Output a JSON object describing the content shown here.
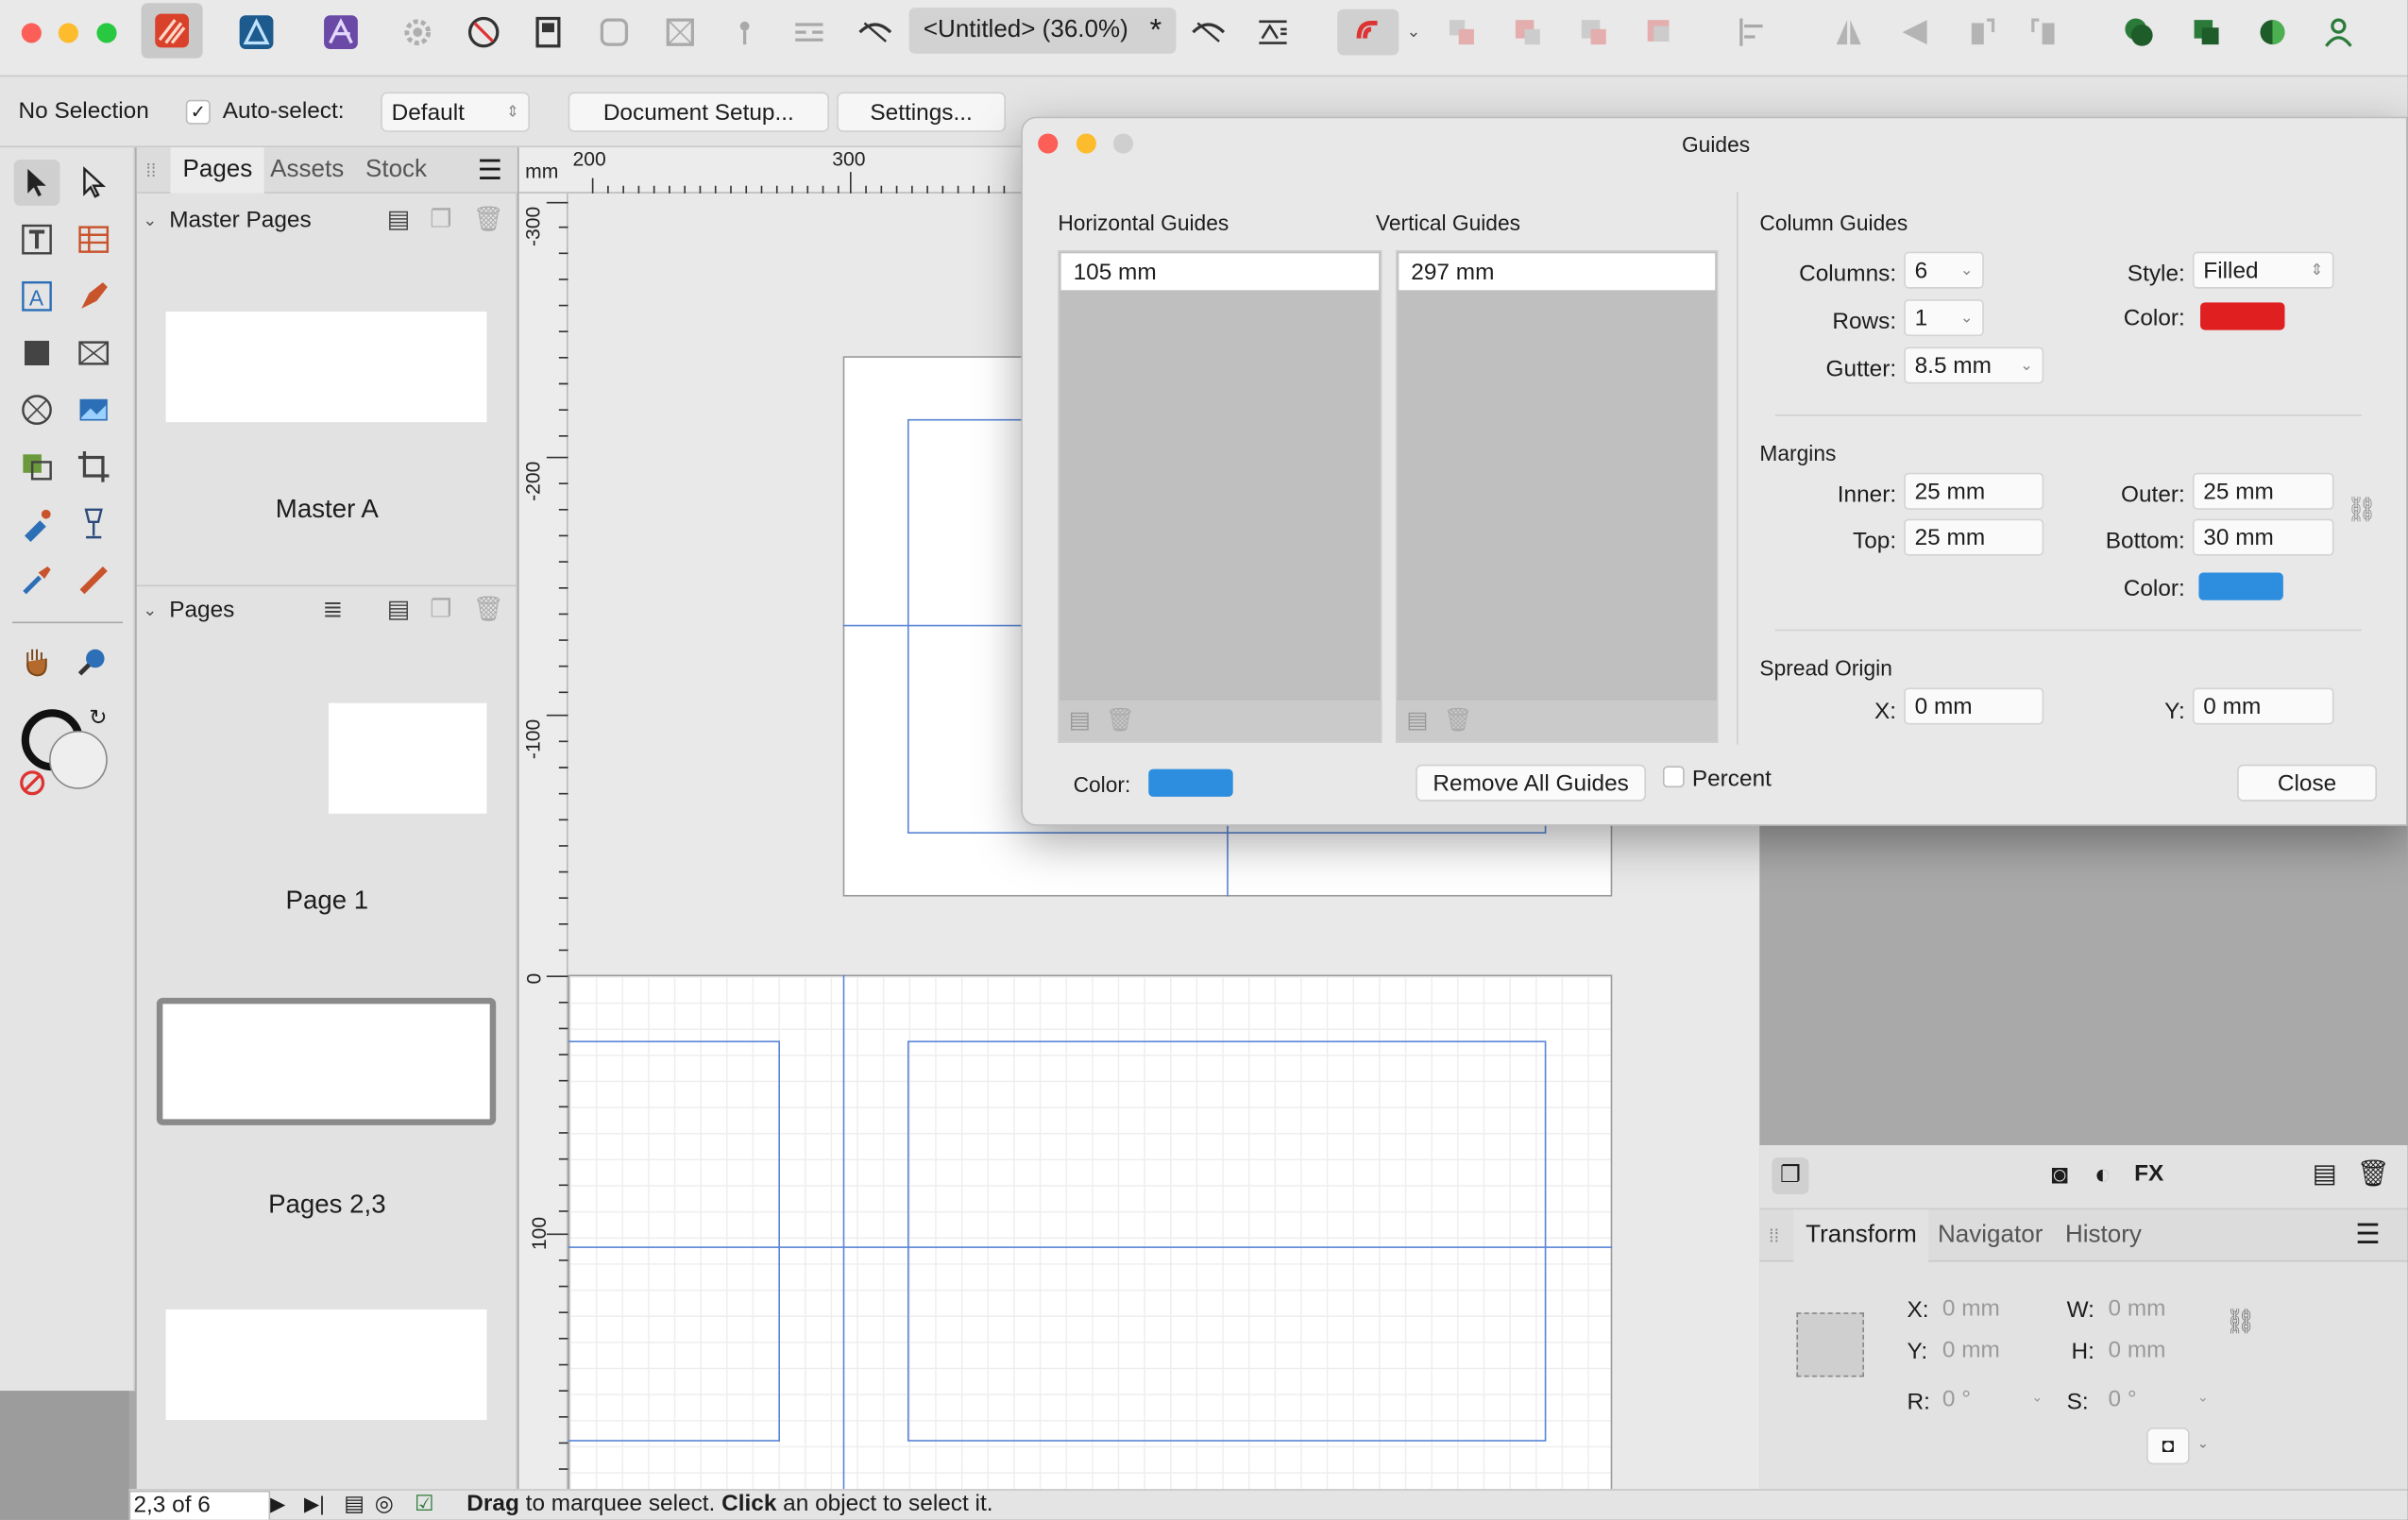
{
  "toolbar": {
    "doc_title": "<Untitled> (36.0%)",
    "modified_mark": "*"
  },
  "context": {
    "selection": "No Selection",
    "autoselect_label": "Auto-select:",
    "autoselect_value": "Default",
    "document_setup": "Document Setup...",
    "settings": "Settings..."
  },
  "pages_panel": {
    "tabs": [
      "Pages",
      "Assets",
      "Stock"
    ],
    "master_header": "Master Pages",
    "master_label": "Master A",
    "pages_header": "Pages",
    "page1_label": "Page 1",
    "pages23_label": "Pages 2,3"
  },
  "rulers": {
    "unit": "mm",
    "top": [
      "200",
      "300"
    ],
    "left": [
      "-300",
      "-200",
      "-100",
      "0",
      "100"
    ]
  },
  "dialog": {
    "title": "Guides",
    "horizontal_header": "Horizontal Guides",
    "vertical_header": "Vertical Guides",
    "horizontal_guides": [
      "105 mm"
    ],
    "vertical_guides": [
      "297 mm"
    ],
    "color_label": "Color:",
    "guide_color": "#2d8ee0",
    "remove_all": "Remove All Guides",
    "percent_label": "Percent",
    "close": "Close",
    "column_guides": {
      "header": "Column Guides",
      "columns_label": "Columns:",
      "columns": "6",
      "rows_label": "Rows:",
      "rows": "1",
      "gutter_label": "Gutter:",
      "gutter": "8.5 mm",
      "style_label": "Style:",
      "style": "Filled",
      "color_label": "Color:",
      "color": "#e02020"
    },
    "margins": {
      "header": "Margins",
      "inner_label": "Inner:",
      "inner": "25 mm",
      "outer_label": "Outer:",
      "outer": "25 mm",
      "top_label": "Top:",
      "top": "25 mm",
      "bottom_label": "Bottom:",
      "bottom": "30 mm",
      "color_label": "Color:",
      "color": "#2d8ee0"
    },
    "spread_origin": {
      "header": "Spread Origin",
      "x_label": "X:",
      "x": "0 mm",
      "y_label": "Y:",
      "y": "0 mm"
    }
  },
  "transform": {
    "tabs": [
      "Transform",
      "Navigator",
      "History"
    ],
    "x_label": "X:",
    "x": "0 mm",
    "y_label": "Y:",
    "y": "0 mm",
    "w_label": "W:",
    "w": "0 mm",
    "h_label": "H:",
    "h": "0 mm",
    "r_label": "R:",
    "r": "0 °",
    "s_label": "S:",
    "s": "0 °"
  },
  "status": {
    "page_indicator": "2,3 of 6",
    "hint_bold1": "Drag",
    "hint_text1": " to marquee select. ",
    "hint_bold2": "Click",
    "hint_text2": " an object to select it."
  }
}
